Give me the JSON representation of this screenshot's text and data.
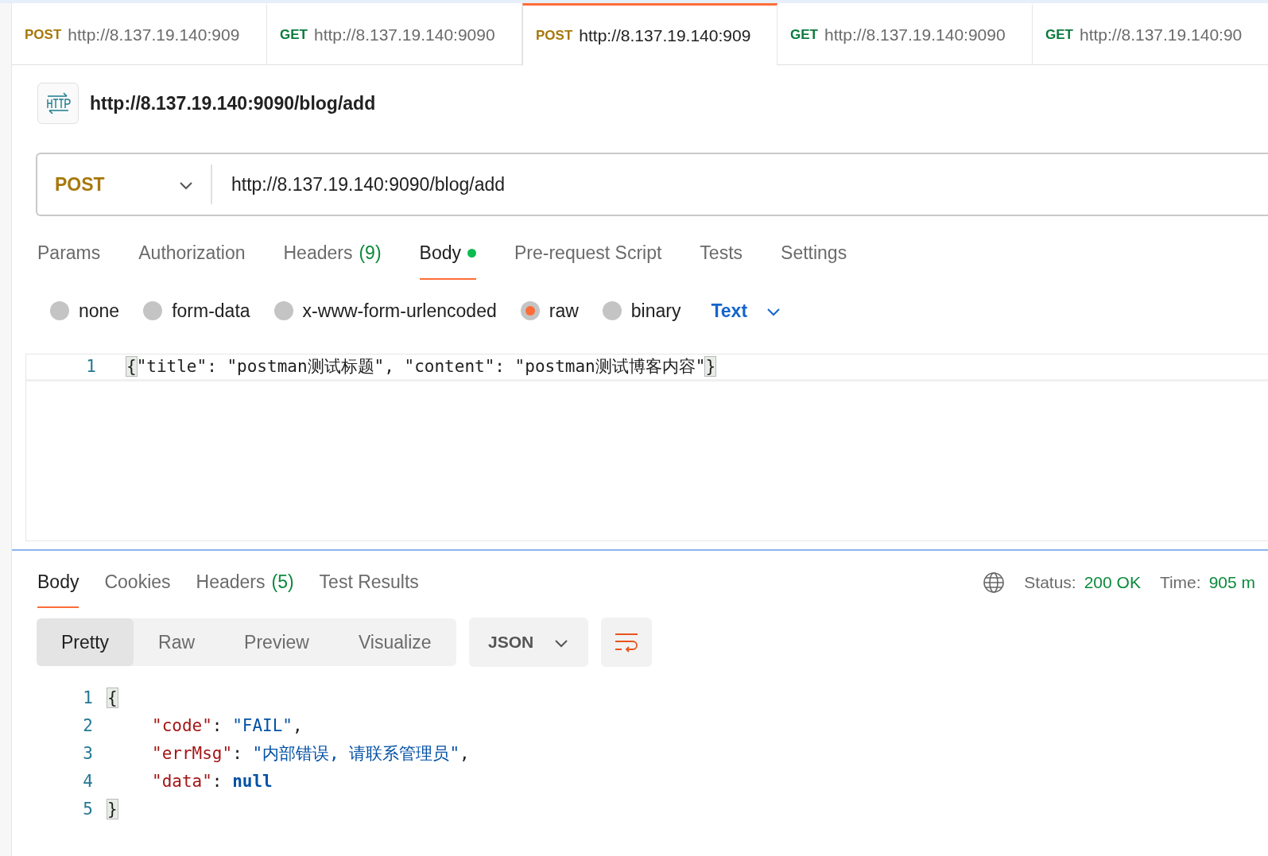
{
  "request_tabs": [
    {
      "method": "POST",
      "url": "http://8.137.19.140:909",
      "selected": false
    },
    {
      "method": "GET",
      "url": "http://8.137.19.140:9090",
      "selected": false
    },
    {
      "method": "POST",
      "url": "http://8.137.19.140:909",
      "selected": true
    },
    {
      "method": "GET",
      "url": "http://8.137.19.140:9090",
      "selected": false
    },
    {
      "method": "GET",
      "url": "http://8.137.19.140:90",
      "selected": false
    }
  ],
  "request_title": "http://8.137.19.140:9090/blog/add",
  "method_select": "POST",
  "url_field": "http://8.137.19.140:9090/blog/add",
  "request_sections": [
    {
      "label": "Params",
      "selected": false
    },
    {
      "label": "Authorization",
      "selected": false
    },
    {
      "label": "Headers",
      "count": "(9)",
      "selected": false
    },
    {
      "label": "Body",
      "dot": true,
      "selected": true
    },
    {
      "label": "Pre-request Script",
      "selected": false
    },
    {
      "label": "Tests",
      "selected": false
    },
    {
      "label": "Settings",
      "selected": false
    }
  ],
  "body_types": [
    {
      "label": "none",
      "selected": false
    },
    {
      "label": "form-data",
      "selected": false
    },
    {
      "label": "x-www-form-urlencoded",
      "selected": false
    },
    {
      "label": "raw",
      "selected": true
    },
    {
      "label": "binary",
      "selected": false
    }
  ],
  "raw_format": "Text",
  "request_body": [
    {
      "number": "1",
      "tokens": [
        {
          "kind": "bracket",
          "text": "{"
        },
        {
          "kind": "plain",
          "text": "\"title\": \"postman测试标题\", \"content\": \"postman测试博客内容\""
        },
        {
          "kind": "bracket",
          "text": "}"
        }
      ]
    }
  ],
  "response_tabs": [
    {
      "label": "Body",
      "selected": true
    },
    {
      "label": "Cookies",
      "selected": false
    },
    {
      "label": "Headers",
      "count": "(5)",
      "selected": false
    },
    {
      "label": "Test Results",
      "selected": false
    }
  ],
  "status_label": "Status:",
  "status_value": "200 OK",
  "time_label": "Time:",
  "time_value": "905 m",
  "view_modes": [
    {
      "label": "Pretty",
      "selected": true
    },
    {
      "label": "Raw",
      "selected": false
    },
    {
      "label": "Preview",
      "selected": false
    },
    {
      "label": "Visualize",
      "selected": false
    }
  ],
  "response_format": "JSON",
  "response_body": [
    {
      "number": "1",
      "tokens": [
        {
          "kind": "bracket",
          "text": "{"
        }
      ]
    },
    {
      "number": "2",
      "tokens": [
        {
          "kind": "key",
          "text": "\"code\""
        },
        {
          "kind": "punct",
          "text": ": "
        },
        {
          "kind": "string",
          "text": "\"FAIL\""
        },
        {
          "kind": "punct",
          "text": ","
        }
      ]
    },
    {
      "number": "3",
      "tokens": [
        {
          "kind": "key",
          "text": "\"errMsg\""
        },
        {
          "kind": "punct",
          "text": ": "
        },
        {
          "kind": "string",
          "text": "\"内部错误, 请联系管理员\""
        },
        {
          "kind": "punct",
          "text": ","
        }
      ]
    },
    {
      "number": "4",
      "tokens": [
        {
          "kind": "key",
          "text": "\"data\""
        },
        {
          "kind": "punct",
          "text": ": "
        },
        {
          "kind": "keyword",
          "text": "null"
        }
      ]
    },
    {
      "number": "5",
      "tokens": [
        {
          "kind": "bracket",
          "text": "}"
        }
      ]
    }
  ]
}
